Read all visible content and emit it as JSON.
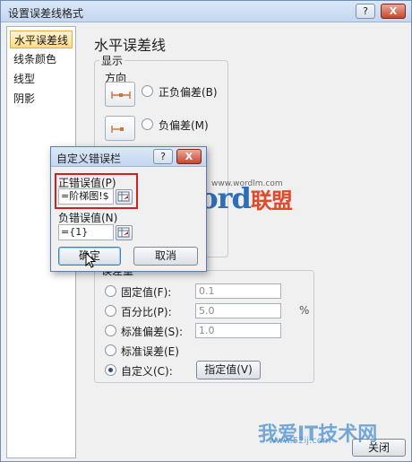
{
  "window": {
    "title": "设置误差线格式",
    "help_label": "?",
    "close_label": "X"
  },
  "nav": {
    "items": [
      "水平误差线",
      "线条颜色",
      "线型",
      "阴影"
    ]
  },
  "main": {
    "heading": "水平误差线",
    "display_group": {
      "label": "显示",
      "direction_label": "方向",
      "options": [
        "正负偏差(B)",
        "负偏差(M)"
      ]
    },
    "error_amount": {
      "label": "误差量",
      "options": [
        "固定值(F):",
        "百分比(P):",
        "标准偏差(S):",
        "标准误差(E)",
        "自定义(C):"
      ],
      "fixed_value": "0.1",
      "percent_value": "5.0",
      "percent_unit": "%",
      "stddev_value": "1.0",
      "specify_button": "指定值(V)",
      "selected": "自定义(C):"
    },
    "close_button": "关闭"
  },
  "dialog": {
    "title": "自定义错误栏",
    "help_label": "?",
    "close_label": "X",
    "positive_label": "正错误值(P)",
    "positive_value": "=阶梯图!$",
    "negative_label": "负错误值(N)",
    "negative_value": "={1}",
    "ok_button": "确定",
    "cancel_button": "取消"
  },
  "watermarks": {
    "brand": "Word",
    "brand_cn": "联盟",
    "brand_url": "www.wordlm.com",
    "site": "我爱IT技术网",
    "site_url": "www.52ij.com"
  },
  "colors": {
    "highlight": "#d12020",
    "title_gradient": "#c4d7ef",
    "nav_selected": "#ffdd84"
  }
}
